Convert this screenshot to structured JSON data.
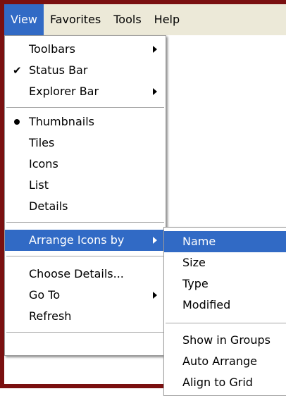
{
  "menubar": {
    "items": [
      "View",
      "Favorites",
      "Tools",
      "Help"
    ]
  },
  "view_menu": {
    "toolbars": "Toolbars",
    "status_bar": "Status Bar",
    "explorer_bar": "Explorer Bar",
    "thumbnails": "Thumbnails",
    "tiles": "Tiles",
    "icons": "Icons",
    "list": "List",
    "details": "Details",
    "arrange_icons_by": "Arrange Icons by",
    "choose_details": "Choose Details...",
    "go_to": "Go To",
    "refresh": "Refresh"
  },
  "arrange_submenu": {
    "name": "Name",
    "size": "Size",
    "type": "Type",
    "modified": "Modified",
    "show_in_groups": "Show in Groups",
    "auto_arrange": "Auto Arrange",
    "align_to_grid": "Align to Grid"
  },
  "colors": {
    "frame": "#7a1010",
    "menubar": "#ece9d8",
    "highlight": "#316ac5"
  },
  "icons": [
    "check-icon",
    "bullet-icon",
    "submenu-arrow-icon"
  ]
}
